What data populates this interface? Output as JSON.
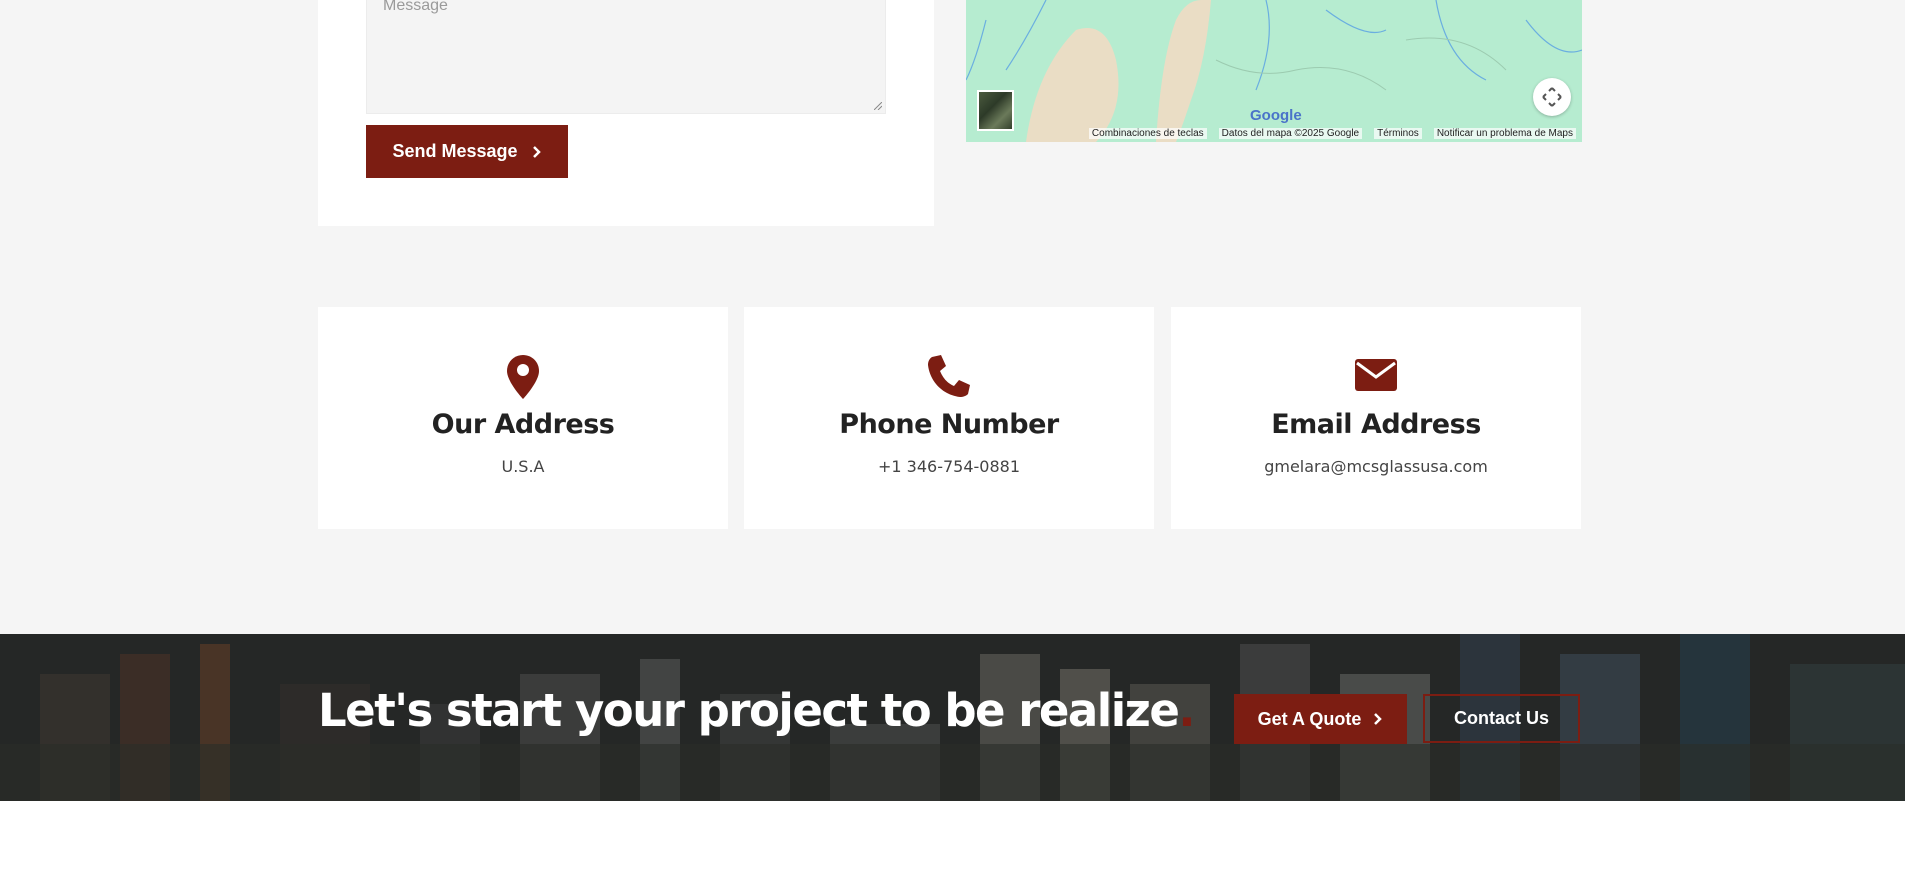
{
  "form": {
    "message_placeholder": "Message",
    "send_label": "Send Message"
  },
  "map": {
    "logo": "Google",
    "footer": {
      "shortcuts": "Combinaciones de teclas",
      "data": "Datos del mapa ©2025 Google",
      "terms": "Términos",
      "report": "Notificar un problema de Maps"
    }
  },
  "contact_cards": [
    {
      "icon": "map-pin-icon",
      "title": "Our Address",
      "value": "U.S.A"
    },
    {
      "icon": "phone-icon",
      "title": "Phone Number",
      "value": "+1 346-754-0881"
    },
    {
      "icon": "envelope-icon",
      "title": "Email Address",
      "value": "gmelara@mcsglassusa.com"
    }
  ],
  "cta": {
    "title": "Let's start your project to be realize",
    "title_dot": ".",
    "quote_label": "Get A Quote",
    "contact_label": "Contact Us"
  },
  "colors": {
    "accent": "#7c1d12",
    "page_bg": "#f5f5f5",
    "map_bg": "#b6ecd0"
  }
}
